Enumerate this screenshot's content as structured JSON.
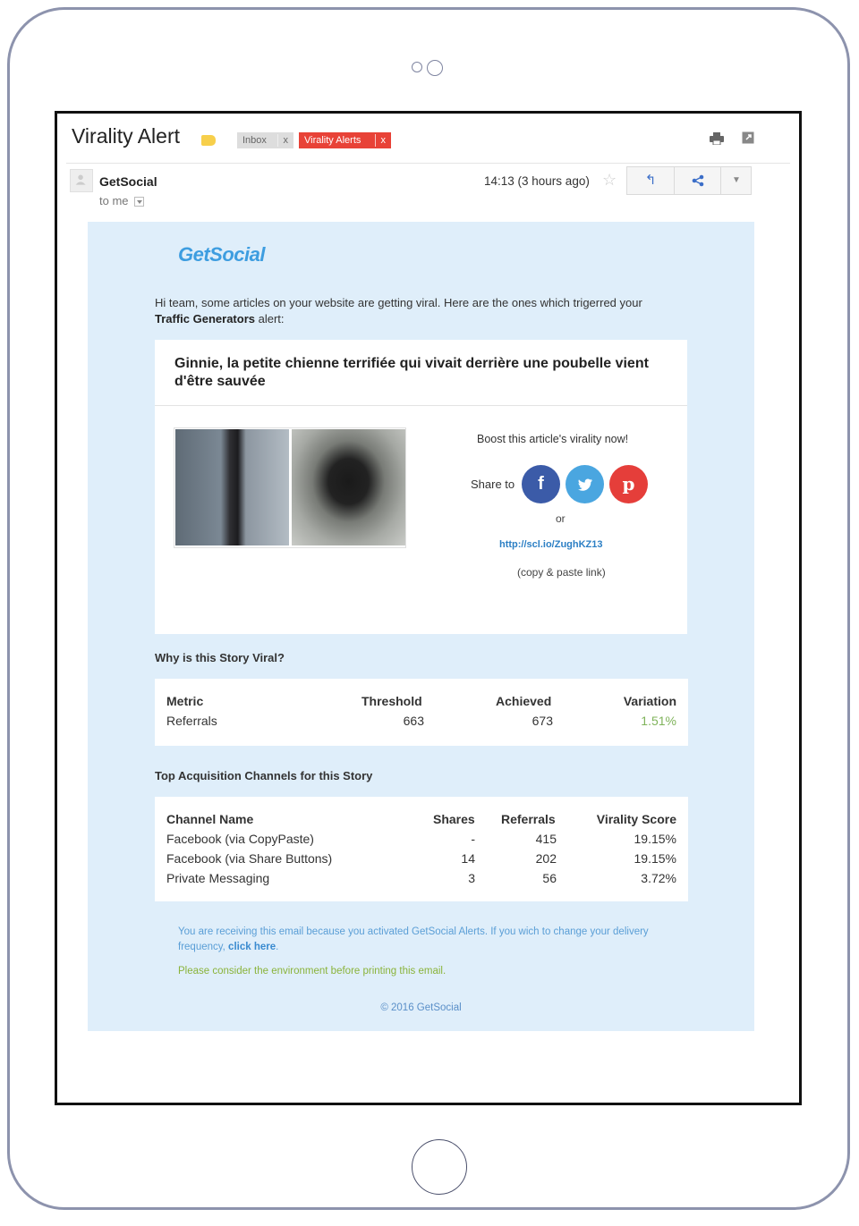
{
  "email_header": {
    "subject": "Virality Alert",
    "labels": [
      {
        "name": "Inbox",
        "remove": "x"
      },
      {
        "name": "Virality Alerts",
        "remove": "x"
      }
    ],
    "sender": "GetSocial",
    "recipient": "to me",
    "timestamp": "14:13 (3 hours ago)",
    "actions": {
      "reply": "reply-icon",
      "share": "share-icon",
      "more": "chevron-down-icon"
    }
  },
  "email_body": {
    "logo": "GetSocial",
    "intro_text": "Hi team, some articles on your website are getting viral. Here are the ones which trigerred your",
    "intro_bold": "Traffic Generators",
    "intro_tail": " alert:",
    "article": {
      "title": "Ginnie, la petite chienne terrifiée qui vivait derrière une poubelle vient d'être sauvée",
      "boost_text": "Boost this article's virality now!",
      "share_to": "Share to",
      "or": "or",
      "link": "http://scl.io/ZughKZ13",
      "copy_note": "(copy & paste link)"
    },
    "why_viral": {
      "heading": "Why is this Story Viral?",
      "headers": [
        "Metric",
        "Threshold",
        "Achieved",
        "Variation"
      ],
      "rows": [
        [
          "Referrals",
          "663",
          "673",
          "1.51%"
        ]
      ]
    },
    "channels": {
      "heading": "Top Acquisition Channels for this Story",
      "headers": [
        "Channel Name",
        "Shares",
        "Referrals",
        "Virality Score"
      ],
      "rows": [
        [
          "Facebook (via CopyPaste)",
          "-",
          "415",
          "19.15%"
        ],
        [
          "Facebook (via Share Buttons)",
          "14",
          "202",
          "19.15%"
        ],
        [
          "Private Messaging",
          "3",
          "56",
          "3.72%"
        ]
      ]
    },
    "footer": {
      "note": "You are receiving this email because you activated GetSocial Alerts. If you wich to change your delivery frequency, ",
      "note_link": "click here",
      "note_end": ".",
      "environment": "Please consider the environment before printing this email.",
      "copyright": "© 2016 GetSocial"
    }
  },
  "colors": {
    "email_bg": "#dfeefa",
    "alert_label": "#e84237",
    "facebook": "#3b5ba8",
    "twitter": "#4aa6e0",
    "pinterest": "#e53e3a",
    "variation_positive": "#7fb35a"
  }
}
